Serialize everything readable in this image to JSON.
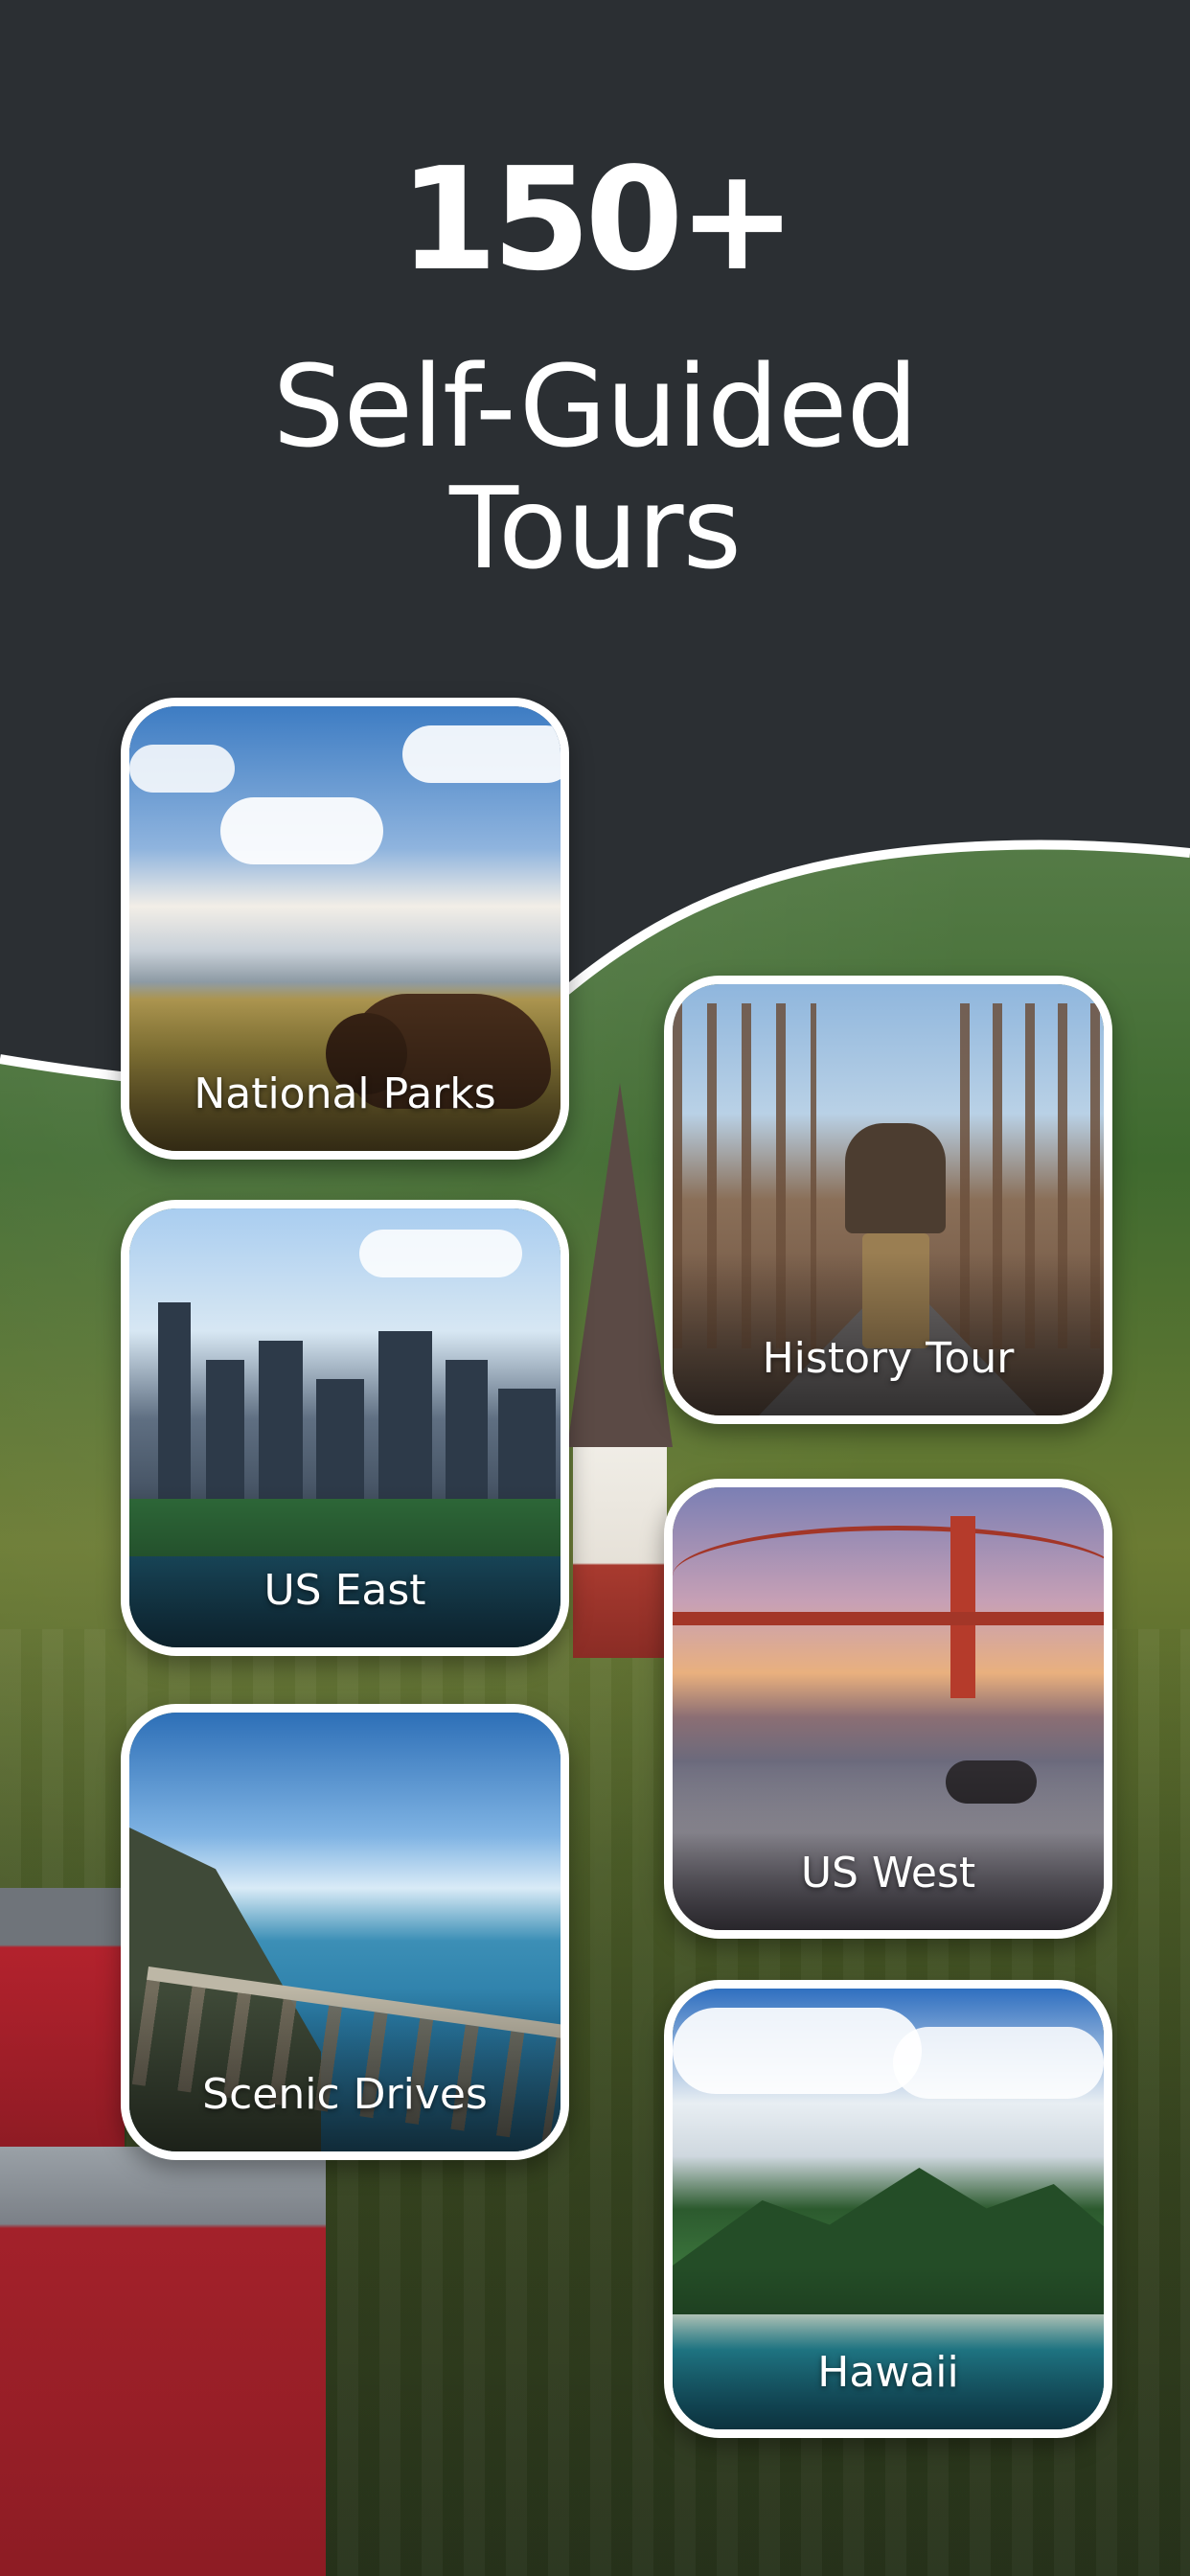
{
  "headline": {
    "count": "150+",
    "title_line1": "Self-Guided",
    "title_line2": "Tours"
  },
  "cards": [
    {
      "label": "National Parks"
    },
    {
      "label": "History Tour"
    },
    {
      "label": "US East"
    },
    {
      "label": "US West"
    },
    {
      "label": "Scenic Drives"
    },
    {
      "label": "Hawaii"
    }
  ],
  "colors": {
    "top_band": "#2b2f33",
    "card_border": "#ffffff",
    "text": "#ffffff"
  }
}
